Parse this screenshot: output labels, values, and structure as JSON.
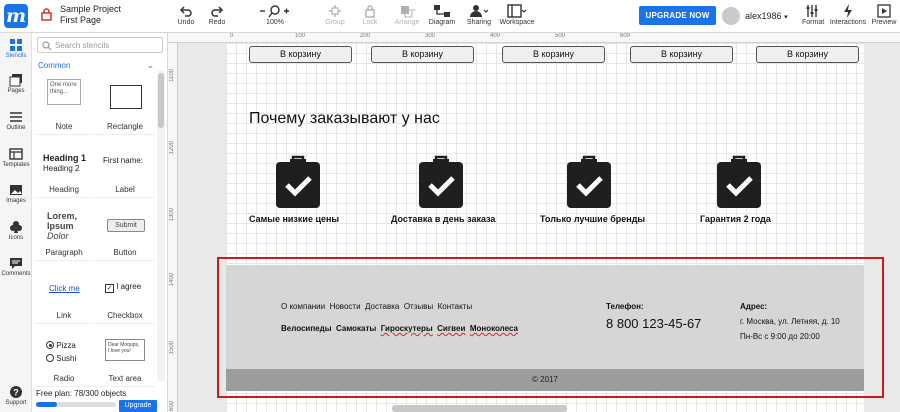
{
  "app": {
    "project_name": "Sample Project",
    "page_name": "First Page"
  },
  "toolbar": {
    "undo": "Undo",
    "redo": "Redo",
    "zoom": "100%",
    "group": "Group",
    "lock": "Lock",
    "arrange": "Arrange",
    "diagram": "Diagram",
    "sharing": "Sharing",
    "workspace": "Workspace",
    "upgrade": "UPGRADE NOW",
    "username": "alex1986",
    "format": "Format",
    "interactions": "Interactions",
    "preview": "Preview"
  },
  "rail": [
    {
      "label": "Stencils",
      "icon": "grid-icon"
    },
    {
      "label": "Pages",
      "icon": "pages-icon"
    },
    {
      "label": "Outline",
      "icon": "outline-icon"
    },
    {
      "label": "Templates",
      "icon": "templates-icon"
    },
    {
      "label": "Images",
      "icon": "image-icon"
    },
    {
      "label": "Icons",
      "icon": "club-icon"
    },
    {
      "label": "Comments",
      "icon": "comment-icon"
    },
    {
      "label": "Support",
      "icon": "help-icon"
    }
  ],
  "stencils": {
    "search_placeholder": "Search stencils",
    "section": "Common",
    "note_text": "One more thing...",
    "heading1": "Heading 1",
    "heading2": "Heading 2",
    "label_text": "First name:",
    "lorem": "Lorem,",
    "ipsum": "Ipsum",
    "dolor": "Dolor",
    "submit": "Submit",
    "link_text": "Click me",
    "checkbox_text": "I agree",
    "radio1": "Pizza",
    "radio2": "Sushi",
    "textarea_text": "Dear Moqups, I love you!",
    "items": [
      "Note",
      "Rectangle",
      "Heading",
      "Label",
      "Paragraph",
      "Button",
      "Link",
      "Checkbox",
      "Radio",
      "Text area"
    ],
    "plan": "Free plan: 78/300 objects",
    "plan_used": 78,
    "plan_total": 300,
    "upgrade": "Upgrade"
  },
  "rulers": {
    "h": [
      "0",
      "100",
      "200",
      "300",
      "400",
      "500",
      "600"
    ],
    "v": [
      "1100",
      "1200",
      "1300",
      "1400",
      "1500",
      "1600"
    ]
  },
  "page": {
    "cart_button": "В корзину",
    "why_title": "Почему заказывают у нас",
    "features": [
      "Самые низкие цены",
      "Доставка в день заказа",
      "Только лучшие бренды",
      "Гарантия 2 года"
    ],
    "footer": {
      "nav1": [
        "О компании",
        "Новости",
        "Доставка",
        "Отзывы",
        "Контакты"
      ],
      "nav2": [
        "Велосипеды",
        "Самокаты",
        "Гироскутеры",
        "Сигвеи",
        "Моноколеса"
      ],
      "phone_label": "Телефон:",
      "phone": "8 800 123-45-67",
      "address_label": "Адрес:",
      "address": "г. Москва, ул. Летняя, д. 10",
      "hours": "Пн-Вс с 9:00 до 20:00",
      "copyright": "© 2017"
    }
  },
  "colors": {
    "accent": "#1a73e8",
    "highlight_frame": "#d01919",
    "footer_bg": "#d6d6d6",
    "footer_band": "#9c9c9c"
  }
}
